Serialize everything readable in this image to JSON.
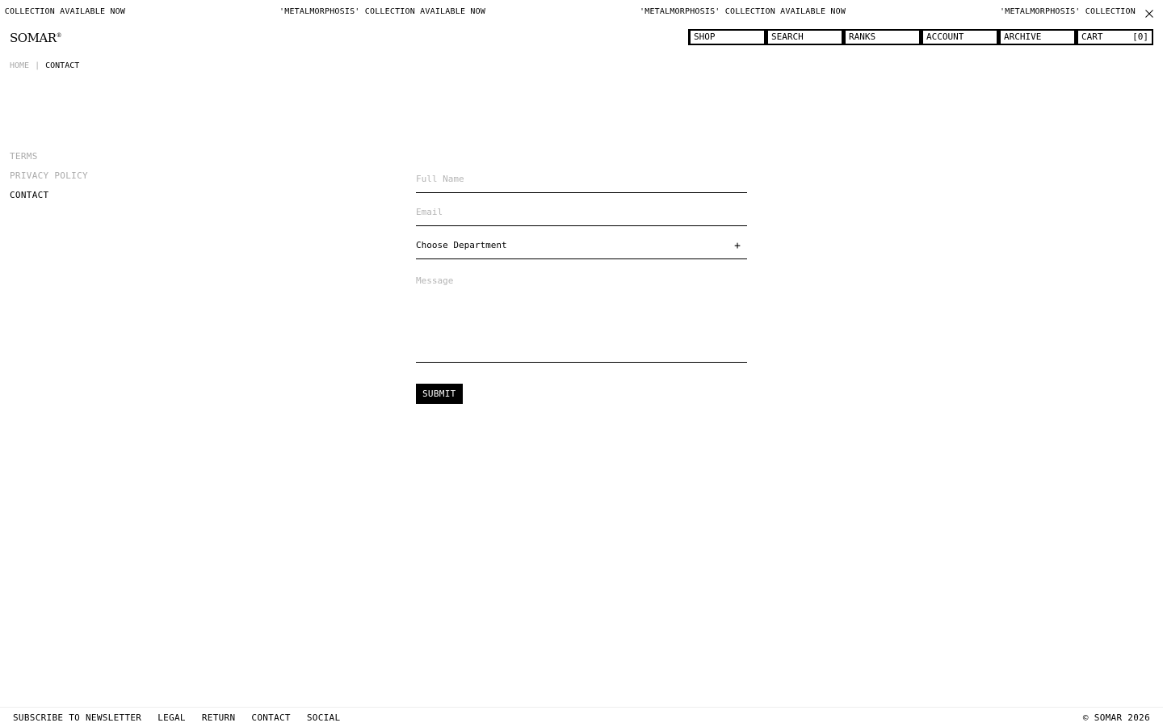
{
  "announcement": {
    "items": [
      "'METALMORPHOSIS' COLLECTION AVAILABLE NOW",
      "'METALMORPHOSIS' COLLECTION AVAILABLE NOW",
      "'METALMORPHOSIS' COLLECTION AVAILABLE NOW",
      "'METALMORPHOSIS' COLLECTION AVAILABLE NOW"
    ],
    "close_icon": "close-icon"
  },
  "header": {
    "logo": "SOMAR",
    "logo_mark": "®",
    "nav": {
      "shop": "SHOP",
      "search": "SEARCH",
      "ranks": "RANKS",
      "account": "ACCOUNT",
      "archive": "ARCHIVE",
      "cart": "CART",
      "cart_count": "[0]"
    }
  },
  "breadcrumb": {
    "home": "HOME",
    "separator": "|",
    "current": "CONTACT"
  },
  "side_nav": {
    "terms": "TERMS",
    "privacy": "PRIVACY POLICY",
    "contact": "CONTACT"
  },
  "form": {
    "full_name_placeholder": "Full Name",
    "email_placeholder": "Email",
    "department_placeholder": "Choose Department",
    "department_icon": "plus-icon",
    "message_placeholder": "Message",
    "submit_label": "SUBMIT"
  },
  "footer": {
    "newsletter": "SUBSCRIBE TO NEWSLETTER",
    "legal": "LEGAL",
    "return": "RETURN",
    "contact": "CONTACT",
    "social": "SOCIAL",
    "copyright": "© SOMAR 2026"
  },
  "colors": {
    "text": "#000000",
    "muted": "#aaaaaa",
    "background": "#ffffff"
  }
}
